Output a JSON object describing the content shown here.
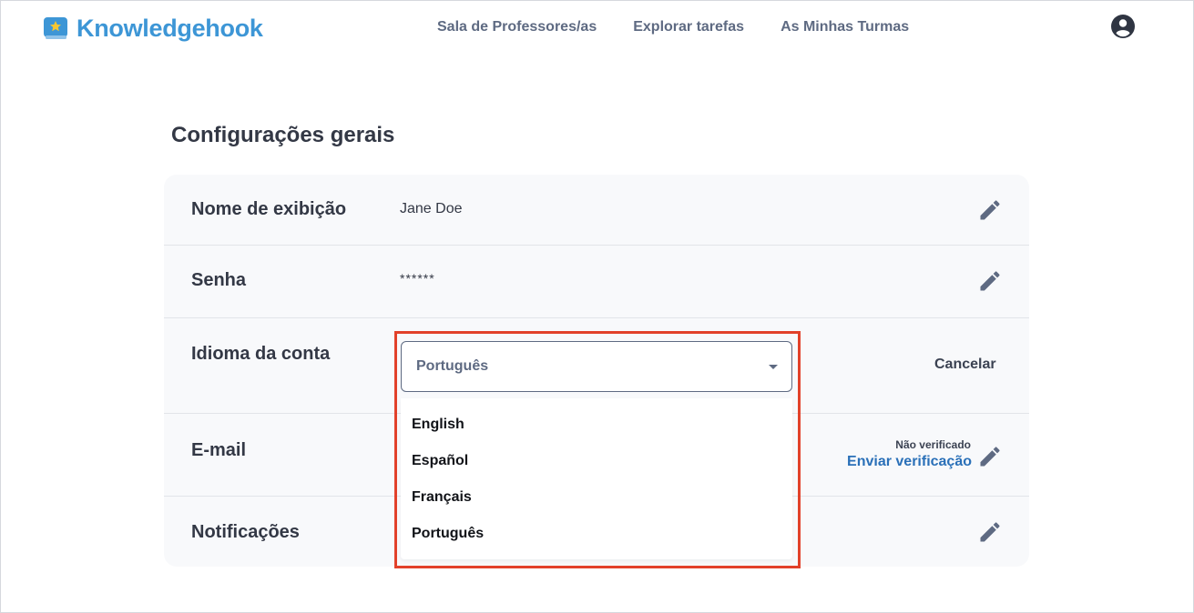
{
  "header": {
    "logo_text": "Knowledgehook",
    "nav": [
      {
        "label": "Sala de Professores/as"
      },
      {
        "label": "Explorar tarefas"
      },
      {
        "label": "As Minhas Turmas"
      }
    ]
  },
  "page": {
    "title": "Configurações gerais"
  },
  "settings": {
    "display_name": {
      "label": "Nome de exibição",
      "value": "Jane Doe"
    },
    "password": {
      "label": "Senha",
      "value": "******"
    },
    "language": {
      "label": "Idioma da conta",
      "selected": "Português",
      "cancel_label": "Cancelar",
      "options": [
        "English",
        "Español",
        "Français",
        "Português"
      ]
    },
    "email": {
      "label": "E-mail",
      "status": "Não verificado",
      "action": "Enviar verificação"
    },
    "notifications": {
      "label": "Notificações"
    }
  },
  "colors": {
    "brand": "#3d96d6",
    "nav_text": "#5e6a82",
    "link_blue": "#2a70b8",
    "highlight_border": "#e2412a"
  },
  "icons": {
    "logo": "book-star-icon",
    "avatar": "user-circle-icon",
    "edit": "pencil-icon",
    "dropdown": "caret-down-icon"
  }
}
